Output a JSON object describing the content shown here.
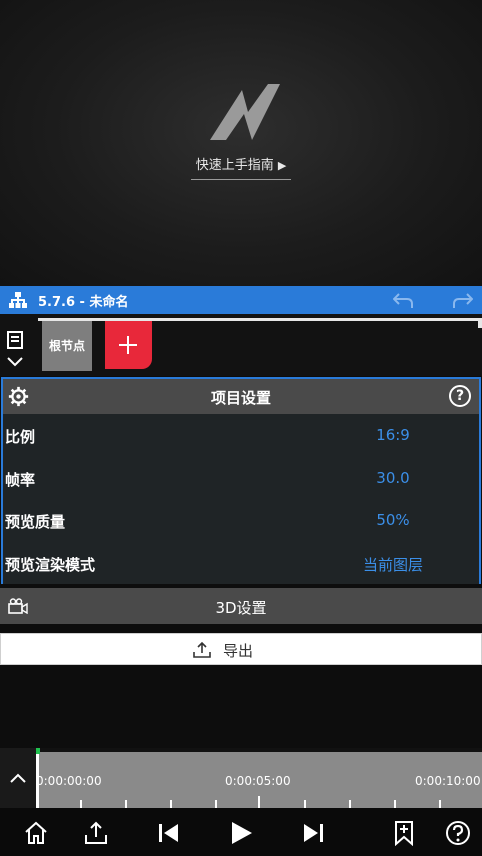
{
  "preview": {
    "guide_label": "快速上手指南",
    "guide_arrow": "▶"
  },
  "titlebar": {
    "title": "5.7.6 - 未命名",
    "color": "#2a7bd9"
  },
  "layers": {
    "root_node_label": "根节点",
    "add_color": "#e8283a"
  },
  "project_settings": {
    "title": "项目设置",
    "help_glyph": "?",
    "rows": [
      {
        "label": "比例",
        "value": "16:9"
      },
      {
        "label": "帧率",
        "value": "30.0"
      },
      {
        "label": "预览质量",
        "value": "50%"
      },
      {
        "label": "预览渲染模式",
        "value": "当前图层"
      }
    ],
    "value_color": "#3b8fe8"
  },
  "settings_3d": {
    "title": "3D设置"
  },
  "export": {
    "label": "导出"
  },
  "timeline": {
    "timecodes": [
      "0:00:00:00",
      "0:00:05:00",
      "0:00:10:00"
    ]
  },
  "bottom_toolbar": {
    "icons": [
      "home-icon",
      "share-icon",
      "skip-back-icon",
      "play-icon",
      "skip-forward-icon",
      "bookmark-icon",
      "help-icon"
    ]
  }
}
